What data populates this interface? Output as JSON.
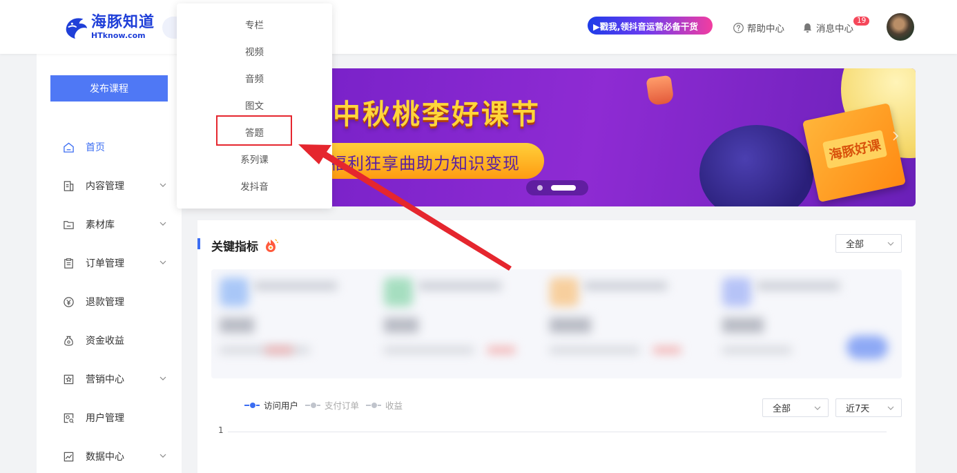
{
  "header": {
    "logo": {
      "cn": "海豚知道",
      "en": "HTknow.com"
    },
    "promo_text": "▶戳我,领抖音运营必备干货",
    "help_label": "帮助中心",
    "message_label": "消息中心",
    "message_count": "19"
  },
  "sidebar": {
    "publish_label": "发布课程",
    "items": [
      {
        "label": "首页",
        "icon": "home-icon",
        "has_chevron": false,
        "active": true
      },
      {
        "label": "内容管理",
        "icon": "document-icon",
        "has_chevron": true
      },
      {
        "label": "素材库",
        "icon": "folder-icon",
        "has_chevron": true
      },
      {
        "label": "订单管理",
        "icon": "clipboard-icon",
        "has_chevron": true
      },
      {
        "label": "退款管理",
        "icon": "yen-icon",
        "has_chevron": false
      },
      {
        "label": "资金收益",
        "icon": "moneybag-icon",
        "has_chevron": false
      },
      {
        "label": "营销中心",
        "icon": "star-badge-icon",
        "has_chevron": true
      },
      {
        "label": "用户管理",
        "icon": "user-card-icon",
        "has_chevron": false
      },
      {
        "label": "数据中心",
        "icon": "chart-icon",
        "has_chevron": true
      }
    ]
  },
  "dropdown": {
    "items": [
      "专栏",
      "视频",
      "音频",
      "图文",
      "答题",
      "系列课",
      "发抖音"
    ],
    "highlighted": "答题"
  },
  "banner": {
    "title": "中秋桃李好课节",
    "subtitle": "福利狂享曲助力知识变现",
    "book_label": "海豚好课"
  },
  "main": {
    "title": "关键指标",
    "scope_filter": "全部",
    "legend": [
      {
        "label": "访问用户",
        "color": "#3b6df2",
        "active": true
      },
      {
        "label": "支付订单",
        "color": "#c0c4cc",
        "active": false
      },
      {
        "label": "收益",
        "color": "#c0c4cc",
        "active": false
      }
    ],
    "chart_filter": "全部",
    "period_filter": "近7天",
    "y_tick": "1"
  },
  "colors": {
    "accent": "#4f78f5",
    "highlight_box": "#e5262e",
    "arrow": "#e5262e"
  }
}
